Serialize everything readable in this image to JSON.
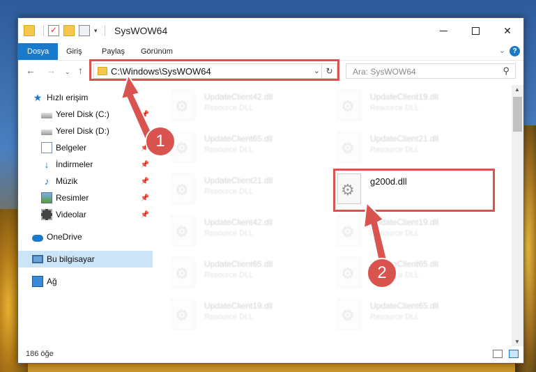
{
  "window": {
    "title": "SysWOW64",
    "quick_access_toolbar_caret": "▾"
  },
  "ribbon": {
    "tabs": [
      {
        "label": "Dosya",
        "active": true
      },
      {
        "label": "Giriş"
      },
      {
        "label": "Paylaş"
      },
      {
        "label": "Görünüm"
      }
    ],
    "help_label": "?"
  },
  "navbar": {
    "address": "C:\\Windows\\SysWOW64",
    "search_placeholder": "Ara: SysWOW64"
  },
  "sidebar": {
    "items": [
      {
        "label": "Hızlı erişim",
        "icon": "star-icon"
      },
      {
        "label": "Yerel Disk (C:)",
        "icon": "drive-icon",
        "pinned": true
      },
      {
        "label": "Yerel Disk (D:)",
        "icon": "drive-icon",
        "pinned": true
      },
      {
        "label": "Belgeler",
        "icon": "documents-icon",
        "pinned": true
      },
      {
        "label": "İndirmeler",
        "icon": "downloads-icon",
        "pinned": true
      },
      {
        "label": "Müzik",
        "icon": "music-icon",
        "pinned": true
      },
      {
        "label": "Resimler",
        "icon": "pictures-icon",
        "pinned": true
      },
      {
        "label": "Videolar",
        "icon": "videos-icon",
        "pinned": true
      },
      {
        "label": "OneDrive",
        "icon": "cloud-icon"
      },
      {
        "label": "Bu bilgisayar",
        "icon": "computer-icon",
        "selected": true
      },
      {
        "label": "Ağ",
        "icon": "network-icon"
      }
    ]
  },
  "files": [
    {
      "name": "UpdateClient42.dll",
      "desc": "Resource DLL"
    },
    {
      "name": "UpdateClient19.dll",
      "desc": "Resource DLL"
    },
    {
      "name": "UpdateClient65.dll",
      "desc": "Resource DLL"
    },
    {
      "name": "UpdateClient21.dll",
      "desc": "Resource DLL"
    },
    {
      "name": "UpdateClient21.dll",
      "desc": "Resource DLL"
    },
    {
      "name": "g200d.dll",
      "desc": ""
    },
    {
      "name": "UpdateClient42.dll",
      "desc": "Resource DLL"
    },
    {
      "name": "UpdateClient19.dll",
      "desc": "Resource DLL"
    },
    {
      "name": "UpdateClient65.dll",
      "desc": "Resource DLL"
    },
    {
      "name": "UpdateClient65.dll",
      "desc": "Resource DLL"
    },
    {
      "name": "UpdateClient19.dll",
      "desc": "Resource DLL"
    },
    {
      "name": "UpdateClient65.dll",
      "desc": "Resource DLL"
    }
  ],
  "status": {
    "item_count": "186 öğe"
  },
  "annotations": {
    "step1": "1",
    "step2": "2",
    "highlight_color": "#d9534f"
  }
}
